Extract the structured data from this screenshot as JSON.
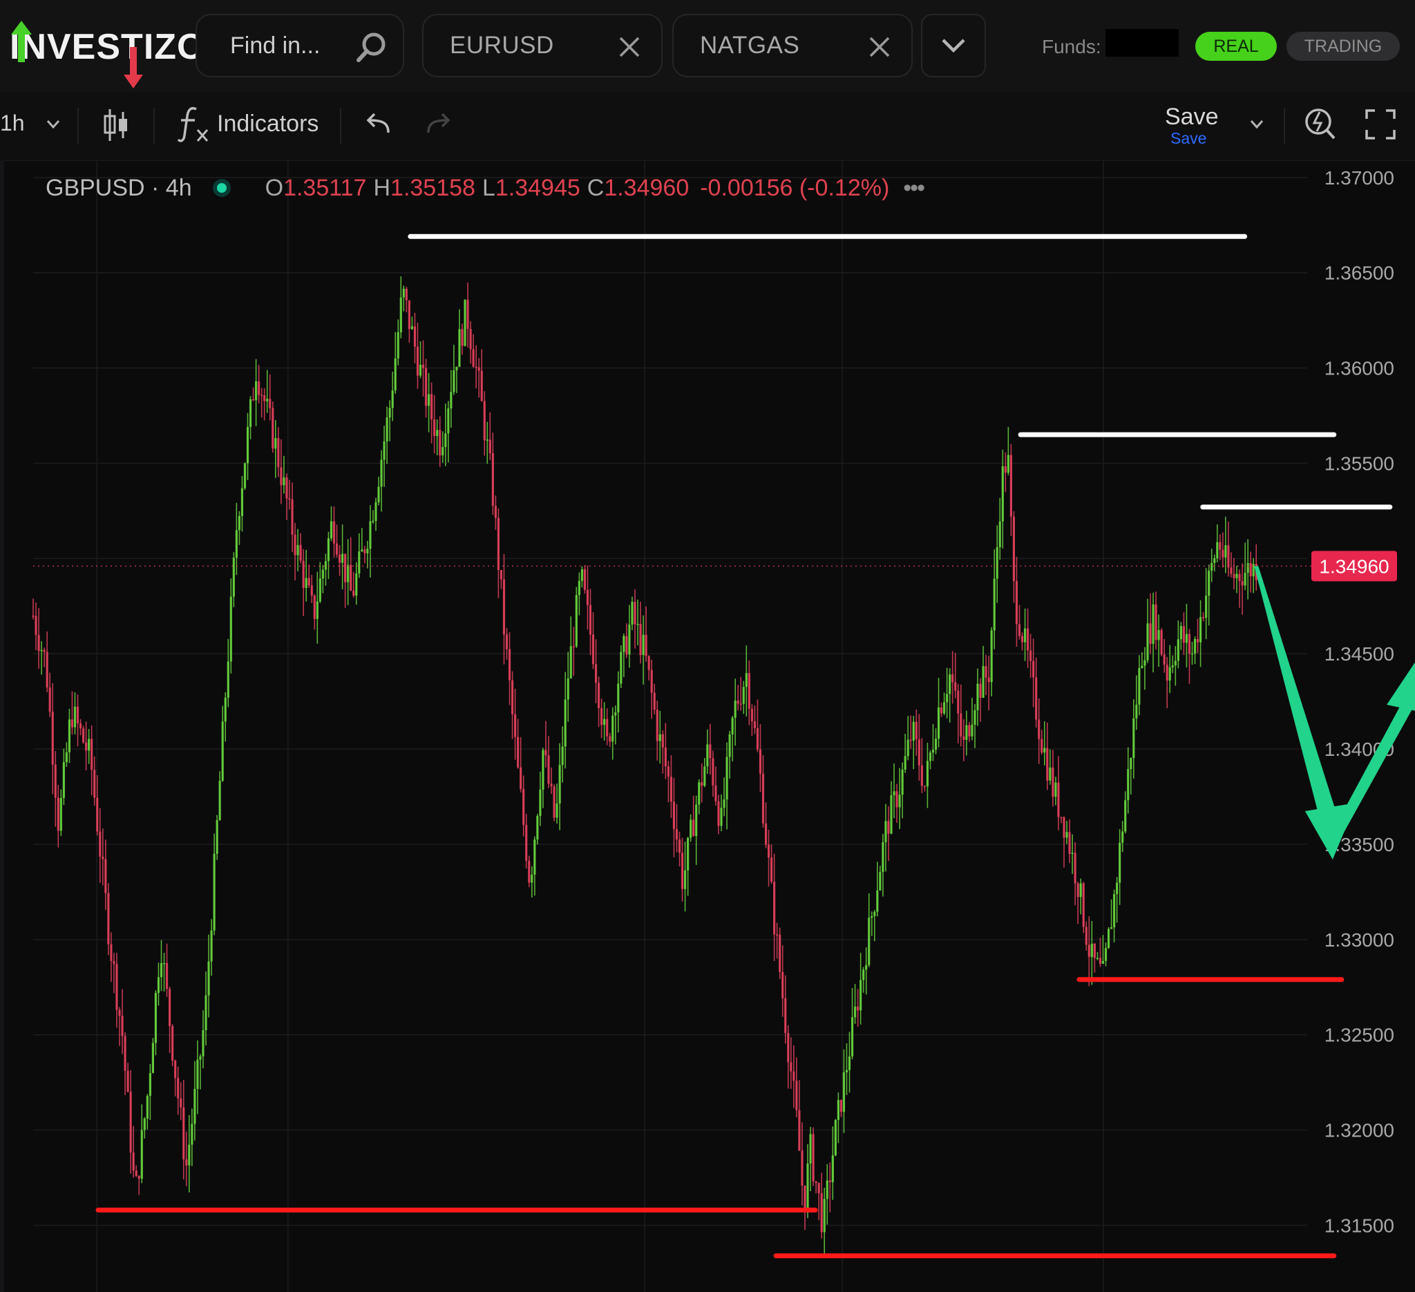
{
  "app": {
    "logo_text": "INVESTIZO"
  },
  "header": {
    "search": {
      "placeholder": "Find in..."
    },
    "tabs": [
      {
        "label": "EURUSD"
      },
      {
        "label": "NATGAS"
      }
    ],
    "funds_label": "Funds:",
    "account_modes": [
      {
        "label": "REAL",
        "active": true
      },
      {
        "label": "TRADING",
        "active": false
      }
    ]
  },
  "toolbar": {
    "timeframe": "1h",
    "indicators_label": "Indicators",
    "save_label": "Save",
    "save_sublabel": "Save"
  },
  "legend": {
    "symbol": "GBPUSD · 4h",
    "open_key": "O",
    "open": "1.35117",
    "high_key": "H",
    "high": "1.35158",
    "low_key": "L",
    "low": "1.34945",
    "close_key": "C",
    "close": "1.34960",
    "change": "-0.00156 (-0.12%)"
  },
  "chart_data": {
    "type": "candlestick",
    "symbol": "GBPUSD",
    "interval": "4h",
    "ylim": [
      1.3115,
      1.3709
    ],
    "y_ticks": [
      "1.37000",
      "1.36500",
      "1.36000",
      "1.35500",
      "1.35000",
      "1.34500",
      "1.34000",
      "1.33500",
      "1.33000",
      "1.32500",
      "1.32000",
      "1.31500"
    ],
    "last_price": "1.34960",
    "colors": {
      "up": "#66d13c",
      "down": "#e0405a",
      "grid": "#1d1d1f",
      "resistance": "#ffffff",
      "support": "#ff1a1a",
      "projection": "#21d38b",
      "last_price_tag": "#e8274f"
    },
    "price_path": [
      [
        0.0,
        1.347
      ],
      [
        0.01,
        1.3445
      ],
      [
        0.02,
        1.336
      ],
      [
        0.03,
        1.342
      ],
      [
        0.045,
        1.3395
      ],
      [
        0.06,
        1.33
      ],
      [
        0.07,
        1.325
      ],
      [
        0.08,
        1.3165
      ],
      [
        0.09,
        1.322
      ],
      [
        0.1,
        1.33
      ],
      [
        0.11,
        1.324
      ],
      [
        0.12,
        1.318
      ],
      [
        0.135,
        1.326
      ],
      [
        0.15,
        1.342
      ],
      [
        0.16,
        1.352
      ],
      [
        0.175,
        1.36
      ],
      [
        0.19,
        1.356
      ],
      [
        0.205,
        1.351
      ],
      [
        0.22,
        1.347
      ],
      [
        0.235,
        1.352
      ],
      [
        0.25,
        1.348
      ],
      [
        0.265,
        1.352
      ],
      [
        0.28,
        1.358
      ],
      [
        0.29,
        1.364
      ],
      [
        0.3,
        1.361
      ],
      [
        0.31,
        1.358
      ],
      [
        0.32,
        1.356
      ],
      [
        0.33,
        1.36
      ],
      [
        0.34,
        1.363
      ],
      [
        0.35,
        1.359
      ],
      [
        0.36,
        1.354
      ],
      [
        0.37,
        1.346
      ],
      [
        0.38,
        1.339
      ],
      [
        0.39,
        1.333
      ],
      [
        0.4,
        1.34
      ],
      [
        0.41,
        1.336
      ],
      [
        0.42,
        1.344
      ],
      [
        0.43,
        1.349
      ],
      [
        0.44,
        1.345
      ],
      [
        0.45,
        1.34
      ],
      [
        0.46,
        1.344
      ],
      [
        0.47,
        1.347
      ],
      [
        0.48,
        1.345
      ],
      [
        0.49,
        1.341
      ],
      [
        0.5,
        1.338
      ],
      [
        0.51,
        1.333
      ],
      [
        0.52,
        1.337
      ],
      [
        0.53,
        1.34
      ],
      [
        0.54,
        1.336
      ],
      [
        0.55,
        1.342
      ],
      [
        0.56,
        1.344
      ],
      [
        0.57,
        1.339
      ],
      [
        0.58,
        1.332
      ],
      [
        0.59,
        1.326
      ],
      [
        0.6,
        1.32
      ],
      [
        0.605,
        1.316
      ],
      [
        0.61,
        1.319
      ],
      [
        0.62,
        1.315
      ],
      [
        0.63,
        1.32
      ],
      [
        0.64,
        1.324
      ],
      [
        0.65,
        1.328
      ],
      [
        0.66,
        1.332
      ],
      [
        0.67,
        1.336
      ],
      [
        0.68,
        1.338
      ],
      [
        0.69,
        1.341
      ],
      [
        0.7,
        1.338
      ],
      [
        0.71,
        1.342
      ],
      [
        0.72,
        1.344
      ],
      [
        0.73,
        1.34
      ],
      [
        0.74,
        1.343
      ],
      [
        0.75,
        1.344
      ],
      [
        0.76,
        1.354
      ],
      [
        0.765,
        1.3555
      ],
      [
        0.77,
        1.348
      ],
      [
        0.78,
        1.345
      ],
      [
        0.79,
        1.341
      ],
      [
        0.8,
        1.338
      ],
      [
        0.81,
        1.336
      ],
      [
        0.82,
        1.333
      ],
      [
        0.83,
        1.329
      ],
      [
        0.84,
        1.328
      ],
      [
        0.85,
        1.333
      ],
      [
        0.86,
        1.339
      ],
      [
        0.87,
        1.345
      ],
      [
        0.88,
        1.347
      ],
      [
        0.89,
        1.344
      ],
      [
        0.9,
        1.346
      ],
      [
        0.91,
        1.345
      ],
      [
        0.92,
        1.348
      ],
      [
        0.93,
        1.351
      ],
      [
        0.94,
        1.349
      ],
      [
        0.96,
        1.3496
      ]
    ],
    "resistance_lines": [
      {
        "x": [
          0.296,
          0.951
        ],
        "y": 1.3669
      },
      {
        "x": [
          0.775,
          1.021
        ],
        "y": 1.3565
      },
      {
        "x": [
          0.918,
          1.065
        ],
        "y": 1.3527
      }
    ],
    "support_lines": [
      {
        "x": [
          0.051,
          0.614
        ],
        "y": 1.3158
      },
      {
        "x": [
          0.821,
          1.027
        ],
        "y": 1.3279
      },
      {
        "x": [
          0.583,
          1.021
        ],
        "y": 1.3134
      }
    ],
    "projection_arrow": {
      "points": [
        [
          0.96,
          1.3496
        ],
        [
          1.02,
          1.3342
        ],
        [
          1.083,
          1.3445
        ]
      ]
    }
  }
}
